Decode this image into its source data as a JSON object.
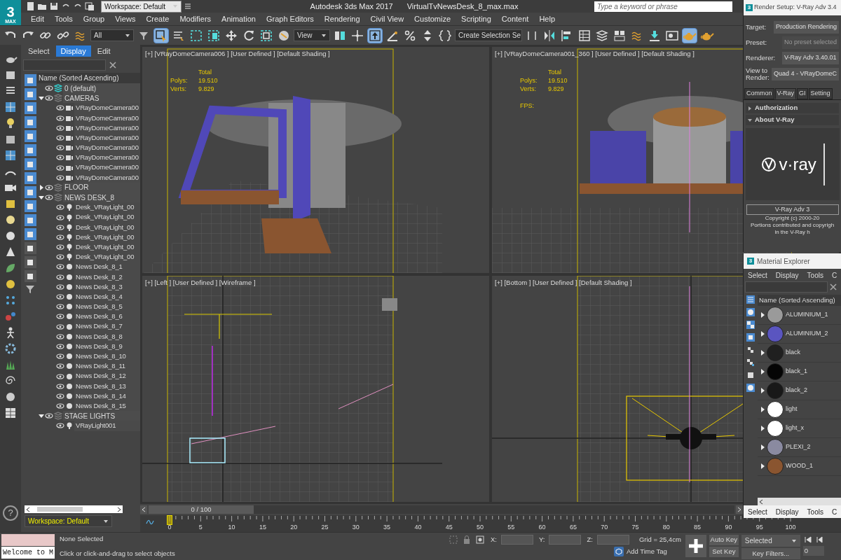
{
  "logo": {
    "glyph": "3",
    "text": "MAX"
  },
  "workspace": "Workspace: Default",
  "app_title": "Autodesk 3ds Max 2017",
  "file_name": "VirtualTvNewsDesk_8_max.max",
  "search": {
    "placeholder": "Type a keyword or phrase"
  },
  "menu": [
    "Edit",
    "Tools",
    "Group",
    "Views",
    "Create",
    "Modifiers",
    "Animation",
    "Graph Editors",
    "Rendering",
    "Civil View",
    "Customize",
    "Scripting",
    "Content",
    "Help"
  ],
  "toolbar": {
    "selection_filter": "All",
    "reference_coordinate": "View",
    "named_selection": "Create Selection Se",
    "tools": [
      {
        "kind": "undo",
        "selected": false
      },
      {
        "kind": "redo",
        "selected": false
      },
      {
        "kind": "link",
        "selected": false
      },
      {
        "kind": "unlink",
        "selected": false
      },
      {
        "kind": "wave",
        "selected": false
      },
      {
        "kind": "filter",
        "selected": false
      },
      {
        "kind": "cursor",
        "selected": true
      },
      {
        "kind": "list",
        "selected": false
      },
      {
        "kind": "dashed",
        "selected": false
      },
      {
        "kind": "window",
        "selected": false
      },
      {
        "kind": "move",
        "selected": false
      },
      {
        "kind": "rotate",
        "selected": false
      },
      {
        "kind": "scale",
        "selected": false
      },
      {
        "kind": "sphere",
        "selected": false
      },
      {
        "kind": "pivot",
        "selected": false
      },
      {
        "kind": "crosshair",
        "selected": false
      },
      {
        "kind": "upload",
        "selected": true
      },
      {
        "kind": "angle",
        "selected": false
      },
      {
        "kind": "percent",
        "selected": false
      },
      {
        "kind": "spinner",
        "selected": false
      },
      {
        "kind": "braces",
        "selected": false
      },
      {
        "kind": "named",
        "selected": false
      },
      {
        "kind": "mirror",
        "selected": false
      },
      {
        "kind": "align",
        "selected": false
      },
      {
        "kind": "table",
        "selected": false
      },
      {
        "kind": "layers",
        "selected": false
      },
      {
        "kind": "grid",
        "selected": false
      },
      {
        "kind": "wave",
        "selected": false
      },
      {
        "kind": "download",
        "selected": false
      },
      {
        "kind": "frame",
        "selected": false
      },
      {
        "kind": "teapot",
        "selected": true
      },
      {
        "kind": "teapot",
        "selected": false
      }
    ]
  },
  "scene_explorer": {
    "tabs": [
      {
        "label": "Select",
        "selected": false
      },
      {
        "label": "Display",
        "selected": true
      },
      {
        "label": "Edit",
        "selected": false
      }
    ],
    "header": "Name (Sorted Ascending)",
    "filters": [
      {
        "selected": true
      },
      {
        "selected": true
      },
      {
        "selected": true
      },
      {
        "selected": true
      },
      {
        "selected": true
      },
      {
        "selected": true
      },
      {
        "selected": true
      },
      {
        "selected": true
      },
      {
        "selected": true
      },
      {
        "selected": true
      },
      {
        "selected": true
      },
      {
        "selected": true
      },
      {
        "selected": false
      },
      {
        "selected": false
      },
      {
        "selected": false
      }
    ],
    "tree": [
      {
        "name": "0 (default)",
        "kind": "active_layer"
      },
      {
        "name": "CAMERAS",
        "kind": "layer",
        "expanded": true,
        "children": [
          {
            "name": "VRayDomeCamera00",
            "kind": "camera"
          },
          {
            "name": "VRayDomeCamera00",
            "kind": "camera"
          },
          {
            "name": "VRayDomeCamera00",
            "kind": "camera"
          },
          {
            "name": "VRayDomeCamera00",
            "kind": "camera"
          },
          {
            "name": "VRayDomeCamera00",
            "kind": "camera"
          },
          {
            "name": "VRayDomeCamera00",
            "kind": "camera"
          },
          {
            "name": "VRayDomeCamera00",
            "kind": "camera"
          },
          {
            "name": "VRayDomeCamera00",
            "kind": "camera"
          }
        ]
      },
      {
        "name": "FLOOR",
        "kind": "layer",
        "expanded": false
      },
      {
        "name": "NEWS DESK_8",
        "kind": "layer",
        "expanded": true,
        "children": [
          {
            "name": "Desk_VRayLight_00",
            "kind": "light"
          },
          {
            "name": "Desk_VRayLight_00",
            "kind": "light"
          },
          {
            "name": "Desk_VRayLight_00",
            "kind": "light"
          },
          {
            "name": "Desk_VRayLight_00",
            "kind": "light"
          },
          {
            "name": "Desk_VRayLight_00",
            "kind": "light"
          },
          {
            "name": "Desk_VRayLight_00",
            "kind": "light"
          },
          {
            "name": "News Desk_8_1",
            "kind": "object"
          },
          {
            "name": "News Desk_8_2",
            "kind": "object"
          },
          {
            "name": "News Desk_8_3",
            "kind": "object"
          },
          {
            "name": "News Desk_8_4",
            "kind": "object"
          },
          {
            "name": "News Desk_8_5",
            "kind": "object"
          },
          {
            "name": "News Desk_8_6",
            "kind": "object"
          },
          {
            "name": "News Desk_8_7",
            "kind": "object"
          },
          {
            "name": "News Desk_8_8",
            "kind": "object"
          },
          {
            "name": "News Desk_8_9",
            "kind": "object"
          },
          {
            "name": "News Desk_8_10",
            "kind": "object"
          },
          {
            "name": "News Desk_8_11",
            "kind": "object"
          },
          {
            "name": "News Desk_8_12",
            "kind": "object"
          },
          {
            "name": "News Desk_8_13",
            "kind": "object"
          },
          {
            "name": "News Desk_8_14",
            "kind": "object"
          },
          {
            "name": "News Desk_8_15",
            "kind": "object"
          }
        ]
      },
      {
        "name": "STAGE LIGHTS",
        "kind": "layer",
        "expanded": true,
        "children": [
          {
            "name": "VRayLight001",
            "kind": "light"
          }
        ]
      }
    ],
    "workspace": "Workspace: Default"
  },
  "viewports": [
    {
      "label": "[+] [VRayDomeCamera006 ] [User Defined ] [Default Shading ]",
      "kind": "side",
      "stats": {
        "heading": "Total",
        "rows": [
          {
            "label": "Polys:",
            "value": "19.510"
          },
          {
            "label": "Verts:",
            "value": "9.829"
          }
        ]
      }
    },
    {
      "label": "[+] [VRayDomeCamera001_360 ] [User Defined ] [Default Shading ]",
      "kind": "front",
      "stats": {
        "heading": "Total",
        "rows": [
          {
            "label": "Polys:",
            "value": "19.510"
          },
          {
            "label": "Verts:",
            "value": "9.829"
          }
        ],
        "fps": "FPS:"
      }
    },
    {
      "label": "[+] [Left ] [User Defined ] [Wireframe ]",
      "kind": "wire"
    },
    {
      "label": "[+] [Bottom ] [User Defined ] [Default Shading ]",
      "kind": "bottom"
    }
  ],
  "render_setup": {
    "logo_glyph": "3",
    "title": "Render Setup: V-Ray Adv 3.4",
    "fields": [
      {
        "label": "Target:",
        "value": "Production Rendering",
        "disabled": false
      },
      {
        "label": "Preset:",
        "value": "No preset selected",
        "disabled": true
      },
      {
        "label": "Renderer:",
        "value": "V-Ray Adv 3.40.01",
        "disabled": false
      },
      {
        "label": "View to Render:",
        "value": "Quad 4 - VRayDomeC",
        "disabled": false
      }
    ],
    "tabs": [
      {
        "label": "Common",
        "selected": false
      },
      {
        "label": "V-Ray",
        "selected": true
      },
      {
        "label": "GI",
        "selected": false
      },
      {
        "label": "Setting",
        "selected": false
      }
    ],
    "rollouts": [
      {
        "label": "Authorization",
        "expanded": false
      },
      {
        "label": "About V-Ray",
        "expanded": true
      }
    ],
    "brand": "v·ray",
    "version": "V-Ray Adv 3",
    "copyright": [
      "Copyright (c) 2000-20",
      "Portions contributed and copyrigh",
      "in the V-Ray h"
    ]
  },
  "material_explorer": {
    "logo_glyph": "3",
    "title": "Material Explorer",
    "menu": [
      "Select",
      "Display",
      "Tools",
      "C"
    ],
    "header": "Name (Sorted Ascending)",
    "materials": [
      {
        "name": "ALUMINIUM_1",
        "color": "#9a9a9a"
      },
      {
        "name": "ALUMINIUM_2",
        "color": "#5a55c0"
      },
      {
        "name": "black",
        "color": "#202020"
      },
      {
        "name": "black_1",
        "color": "#050505"
      },
      {
        "name": "black_2",
        "color": "#181818"
      },
      {
        "name": "light",
        "color": "#ffffff"
      },
      {
        "name": "light_x",
        "color": "#ffffff"
      },
      {
        "name": "PLEXI_2",
        "color": "#8a8aa0"
      },
      {
        "name": "WOOD_1",
        "color": "#8a5530"
      }
    ],
    "bottom_menu": [
      "Select",
      "Display",
      "Tools",
      "C"
    ]
  },
  "timeline": {
    "frame": "0 / 100",
    "ticks": [
      "0",
      "5",
      "10",
      "15",
      "20",
      "25",
      "30",
      "35",
      "40",
      "45",
      "50",
      "55",
      "60",
      "65",
      "70",
      "75",
      "80",
      "85",
      "90",
      "95",
      "100"
    ]
  },
  "status": {
    "help_glyph": "?",
    "listener": "Welcome to M",
    "selection": "None Selected",
    "prompt": "Click or click-and-drag to select objects",
    "coords": [
      "X:",
      "Y:",
      "Z:"
    ],
    "grid": "Grid = 25,4cm",
    "time_tag": "Add Time Tag",
    "auto_key": "Auto Key",
    "set_key": "Set Key",
    "key_mode": "Selected",
    "key_filters": "Key Filters...",
    "frame_value": "0"
  }
}
